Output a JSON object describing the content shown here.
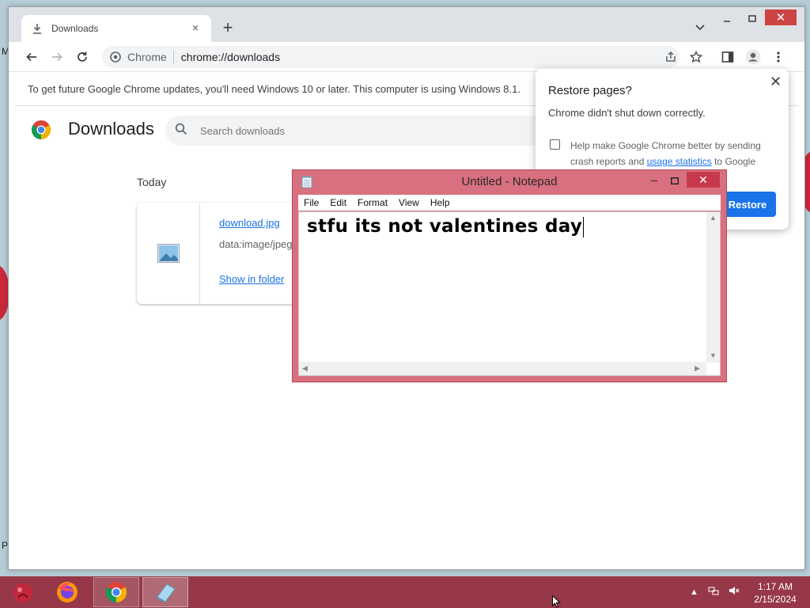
{
  "desktop": {
    "edge_letters": [
      "M",
      "P"
    ]
  },
  "chrome": {
    "tab": {
      "title": "Downloads",
      "close": "×"
    },
    "new_tab": "+",
    "window_close": "✕",
    "omnibox": {
      "chip": "Chrome",
      "url": "chrome://downloads"
    },
    "update_bar": "To get future Google Chrome updates, you'll need Windows 10 or later. This computer is using Windows 8.1."
  },
  "downloads": {
    "title": "Downloads",
    "search_placeholder": "Search downloads",
    "section": "Today",
    "item": {
      "filename": "download.jpg",
      "source": "data:image/jpeg",
      "show_in_folder": "Show in folder"
    }
  },
  "restore_popup": {
    "title": "Restore pages?",
    "message": "Chrome didn't shut down correctly.",
    "help_prefix": "Help make Google Chrome better by sending crash reports and ",
    "help_link": "usage statistics",
    "help_suffix": " to Google",
    "close": "✕",
    "button": "Restore"
  },
  "notepad": {
    "title": "Untitled - Notepad",
    "menu": [
      "File",
      "Edit",
      "Format",
      "View",
      "Help"
    ],
    "content": "stfu its not valentines day",
    "close": "✕",
    "minimize": "–"
  },
  "taskbar": {
    "clock_time": "1:17 AM",
    "clock_date": "2/15/2024"
  },
  "colors": {
    "notepad_frame": "#d9707f",
    "taskbar": "#963848",
    "chrome_accent": "#1a73e8"
  }
}
